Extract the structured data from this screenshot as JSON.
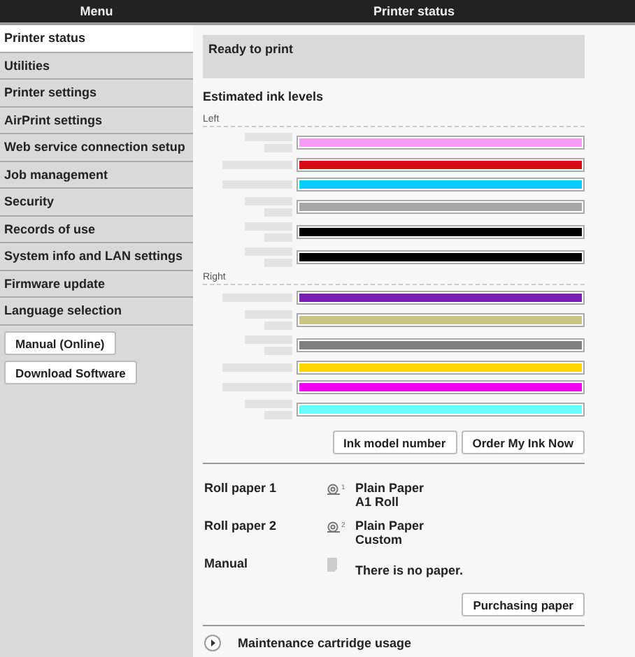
{
  "header": {
    "menu_title": "Menu",
    "page_title": "Printer status"
  },
  "sidebar": {
    "items": [
      {
        "label": "Printer status",
        "selected": true
      },
      {
        "label": "Utilities",
        "selected": false
      },
      {
        "label": "Printer settings",
        "selected": false
      },
      {
        "label": "AirPrint settings",
        "selected": false
      },
      {
        "label": "Web service connection setup",
        "selected": false
      },
      {
        "label": "Job management",
        "selected": false
      },
      {
        "label": "Security",
        "selected": false
      },
      {
        "label": "Records of use",
        "selected": false
      },
      {
        "label": "System info and LAN settings",
        "selected": false
      },
      {
        "label": "Firmware update",
        "selected": false
      },
      {
        "label": "Language selection",
        "selected": false
      }
    ],
    "buttons": [
      "Manual (Online)",
      "Download Software"
    ]
  },
  "status": "Ready to print",
  "ink": {
    "title": "Estimated ink levels",
    "groups": [
      {
        "label": "Left",
        "inks": [
          {
            "kind": "two-line",
            "color": "#f59cf5",
            "level": 1
          },
          {
            "kind": "one-line",
            "color": "#d50a17",
            "level": 1
          },
          {
            "kind": "one-line",
            "color": "#00ccff",
            "level": 1
          },
          {
            "kind": "two-line",
            "color": "#a6a6a6",
            "level": 1
          },
          {
            "kind": "two-line",
            "color": "#000000",
            "level": 1
          },
          {
            "kind": "two-line",
            "color": "#000000",
            "level": 1
          }
        ]
      },
      {
        "label": "Right",
        "inks": [
          {
            "kind": "one-line",
            "color": "#7a1cb8",
            "level": 1
          },
          {
            "kind": "two-line",
            "color": "#c8c486",
            "level": 1
          },
          {
            "kind": "two-line",
            "color": "#7f7f7f",
            "level": 1
          },
          {
            "kind": "one-line",
            "color": "#ffd700",
            "level": 1
          },
          {
            "kind": "one-line",
            "color": "#ee00ee",
            "level": 1
          },
          {
            "kind": "two-line",
            "color": "#66ffff",
            "level": 1
          }
        ]
      }
    ],
    "buttons": [
      "Ink model number",
      "Order My Ink Now"
    ]
  },
  "paper": [
    {
      "kind": "roll",
      "label": "Roll paper 1",
      "icon_number": "1",
      "lines": [
        "Plain Paper",
        "A1 Roll"
      ]
    },
    {
      "kind": "roll",
      "label": "Roll paper 2",
      "icon_number": "2",
      "lines": [
        "Plain Paper",
        "Custom"
      ]
    },
    {
      "kind": "sheet",
      "label": "Manual",
      "lines": [
        "There is no paper."
      ]
    }
  ],
  "paper_button": "Purchasing paper",
  "maintenance": {
    "label": "Maintenance cartridge usage",
    "expanded": false
  }
}
